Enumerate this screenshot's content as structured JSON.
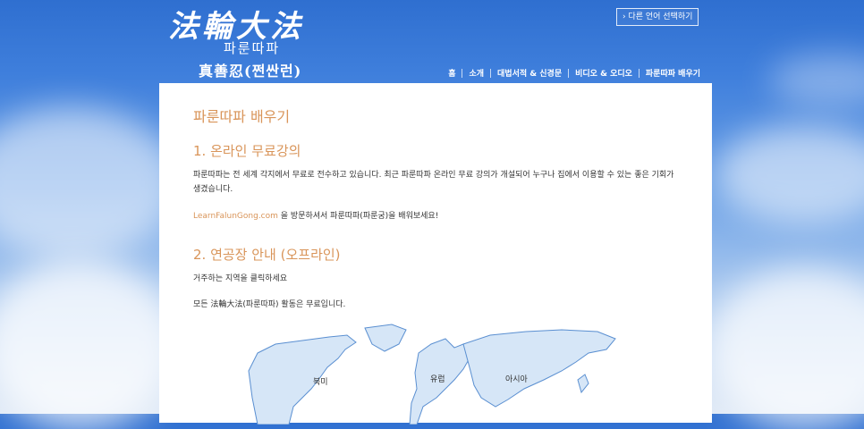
{
  "header": {
    "logo_chinese": "法輪大法",
    "logo_korean": "파룬따파",
    "logo_sub": "真善忍(쩐싼런)",
    "language_button": "› 다른 언어 선택하기"
  },
  "nav": {
    "items": [
      "홈",
      "소개",
      "대법서적 & 신경문",
      "비디오 & 오디오",
      "파룬따파 배우기"
    ]
  },
  "page": {
    "title": "파룬따파 배우기",
    "section1_heading": "1. 온라인 무료강의",
    "section1_text": "파룬따파는 전 세계 각지에서 무료로 전수하고 있습니다. 최근 파룬따파 온라인 무료 강의가 개설되어 누구나 집에서 이용할 수 있는 좋은 기회가 생겼습니다.",
    "section1_link": "LearnFalunGong.com",
    "section1_link_suffix": " 을 방문하셔서 파룬따파(파룬궁)을 배워보세요!",
    "section2_heading": "2. 연공장 안내 (오프라인)",
    "section2_text1": "거주하는 지역을 클릭하세요",
    "section2_text2": "모든 法輪大法(파룬따파) 활동은 무료입니다."
  },
  "map": {
    "regions": [
      "북미",
      "유럽",
      "아시아"
    ],
    "land_color": "#d6e6f7",
    "border_color": "#5a8fd1"
  }
}
